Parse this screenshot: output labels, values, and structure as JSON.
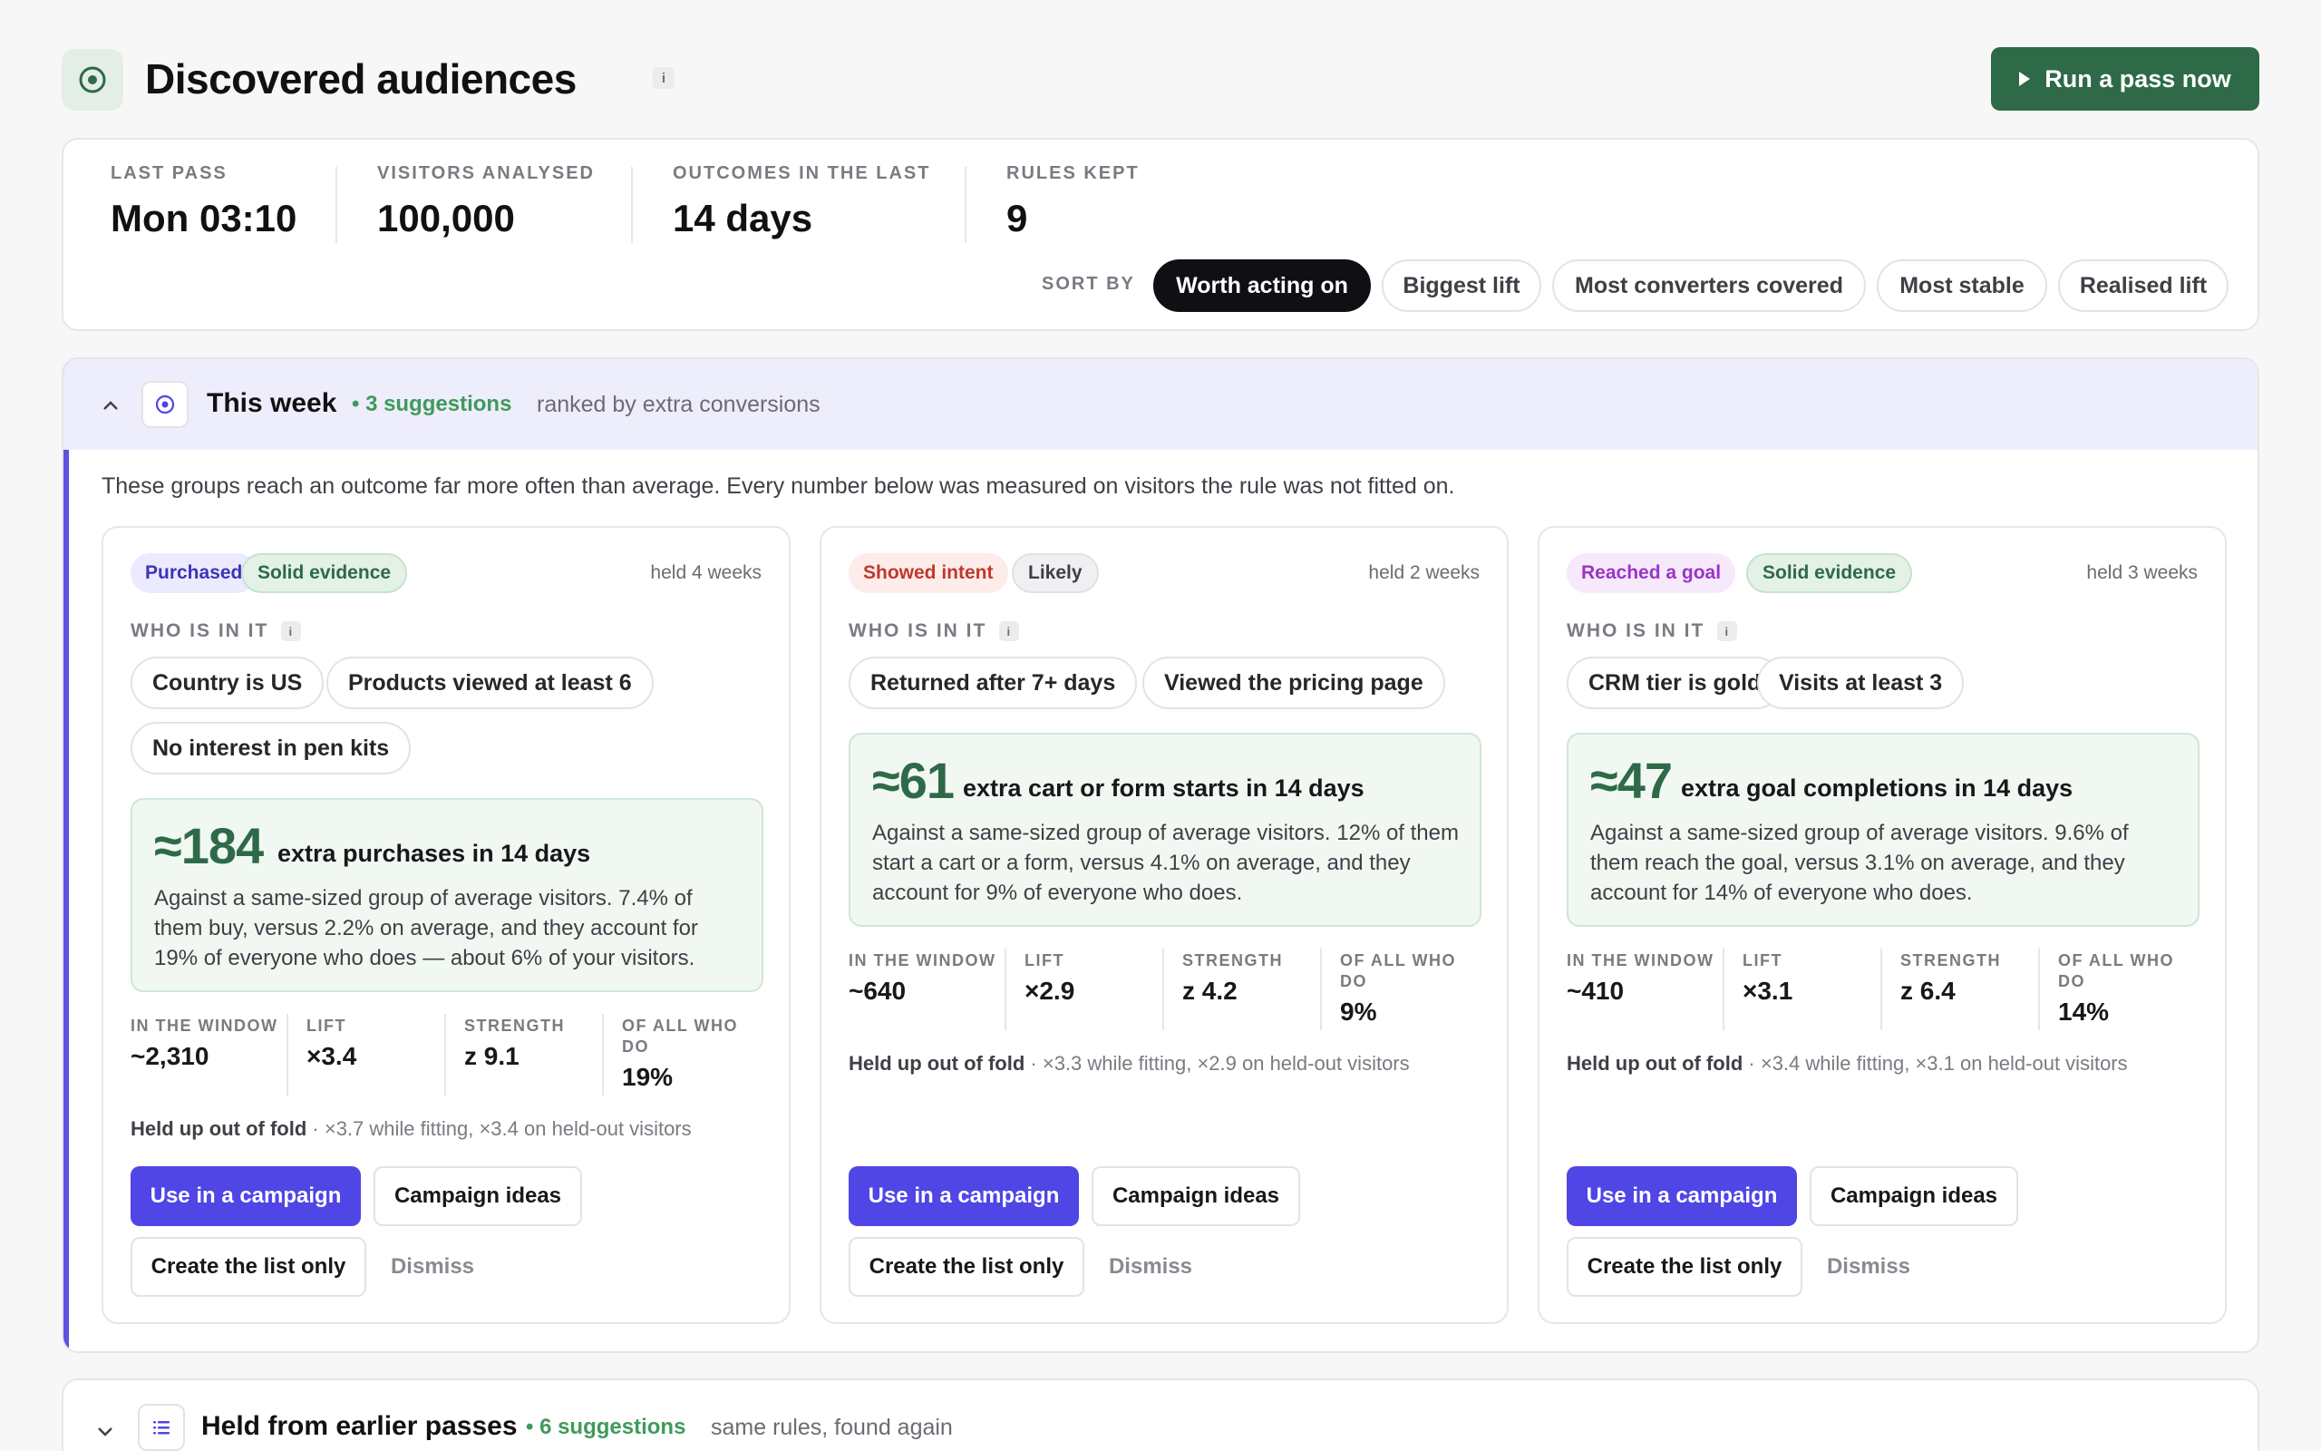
{
  "header": {
    "title": "Discovered audiences",
    "info": "i",
    "run_button": "Run a pass now"
  },
  "stats": [
    {
      "label": "LAST PASS",
      "value": "Mon 03:10"
    },
    {
      "label": "VISITORS ANALYSED",
      "value": "100,000"
    },
    {
      "label": "OUTCOMES IN THE LAST",
      "value": "14 days"
    },
    {
      "label": "RULES KEPT",
      "value": "9"
    }
  ],
  "sort": {
    "label": "SORT BY",
    "options": [
      "Worth acting on",
      "Biggest lift",
      "Most converters covered",
      "Most stable",
      "Realised lift"
    ],
    "selected": "Worth acting on"
  },
  "this_week": {
    "title": "This week",
    "count": "• 3 suggestions",
    "subtitle": "ranked by extra conversions",
    "description": "These groups reach an outcome far more often than average. Every number below was measured on visitors the rule was not fitted on.",
    "cards": [
      {
        "outcome_badge": "Purchased",
        "evidence_badge": "Solid evidence",
        "held": "held 4 weeks",
        "who_label": "WHO IS IN IT",
        "rules": [
          "Country is US",
          "Products viewed at least 6",
          "No interest in pen kits"
        ],
        "impact_value": "≈184",
        "impact_head": "extra purchases in 14 days",
        "impact_text": "Against a same-sized group of average visitors. 7.4% of them buy, versus 2.2% on average, and they account for 19% of everyone who does — about 6% of your visitors.",
        "metrics": [
          {
            "label": "IN THE WINDOW",
            "value": "~2,310"
          },
          {
            "label": "LIFT",
            "value": "×3.4"
          },
          {
            "label": "STRENGTH",
            "value": "z 9.1"
          },
          {
            "label": "OF ALL WHO DO",
            "value": "19%"
          }
        ],
        "heldup_strong": "Held up out of fold",
        "heldup_rest": " · ×3.7 while fitting, ×3.4 on held-out visitors",
        "btn_use": "Use in a campaign",
        "btn_ideas": "Campaign ideas",
        "btn_list": "Create the list only",
        "btn_dismiss": "Dismiss"
      },
      {
        "outcome_badge": "Showed intent",
        "evidence_badge": "Likely",
        "held": "held 2 weeks",
        "who_label": "WHO IS IN IT",
        "rules": [
          "Returned after 7+ days",
          "Viewed the pricing page"
        ],
        "impact_value": "≈61",
        "impact_head": "extra cart or form starts in 14 days",
        "impact_text": "Against a same-sized group of average visitors. 12% of them start a cart or a form, versus 4.1% on average, and they account for 9% of everyone who does.",
        "metrics": [
          {
            "label": "IN THE WINDOW",
            "value": "~640"
          },
          {
            "label": "LIFT",
            "value": "×2.9"
          },
          {
            "label": "STRENGTH",
            "value": "z 4.2"
          },
          {
            "label": "OF ALL WHO DO",
            "value": "9%"
          }
        ],
        "heldup_strong": "Held up out of fold",
        "heldup_rest": " · ×3.3 while fitting, ×2.9 on held-out visitors",
        "btn_use": "Use in a campaign",
        "btn_ideas": "Campaign ideas",
        "btn_list": "Create the list only",
        "btn_dismiss": "Dismiss"
      },
      {
        "outcome_badge": "Reached a goal",
        "evidence_badge": "Solid evidence",
        "held": "held 3 weeks",
        "who_label": "WHO IS IN IT",
        "rules": [
          "CRM tier is gold",
          "Visits at least 3"
        ],
        "impact_value": "≈47",
        "impact_head": "extra goal completions in 14 days",
        "impact_text": "Against a same-sized group of average visitors. 9.6% of them reach the goal, versus 3.1% on average, and they account for 14% of everyone who does.",
        "metrics": [
          {
            "label": "IN THE WINDOW",
            "value": "~410"
          },
          {
            "label": "LIFT",
            "value": "×3.1"
          },
          {
            "label": "STRENGTH",
            "value": "z 6.4"
          },
          {
            "label": "OF ALL WHO DO",
            "value": "14%"
          }
        ],
        "heldup_strong": "Held up out of fold",
        "heldup_rest": " · ×3.4 while fitting, ×3.1 on held-out visitors",
        "btn_use": "Use in a campaign",
        "btn_ideas": "Campaign ideas",
        "btn_list": "Create the list only",
        "btn_dismiss": "Dismiss"
      }
    ]
  },
  "earlier": {
    "title": "Held from earlier passes",
    "count": "• 6 suggestions",
    "subtitle": "same rules, found again"
  },
  "colors": {
    "brand_green": "#2e6a48",
    "primary_button": "#4f46e5",
    "section_accent": "#5b52e0",
    "badge_purchased": "#eceaff",
    "badge_intent": "#fdecea",
    "badge_goal": "#f5e9fb",
    "badge_solid": "#e3f1e6",
    "badge_likely": "#f0f0f2"
  }
}
